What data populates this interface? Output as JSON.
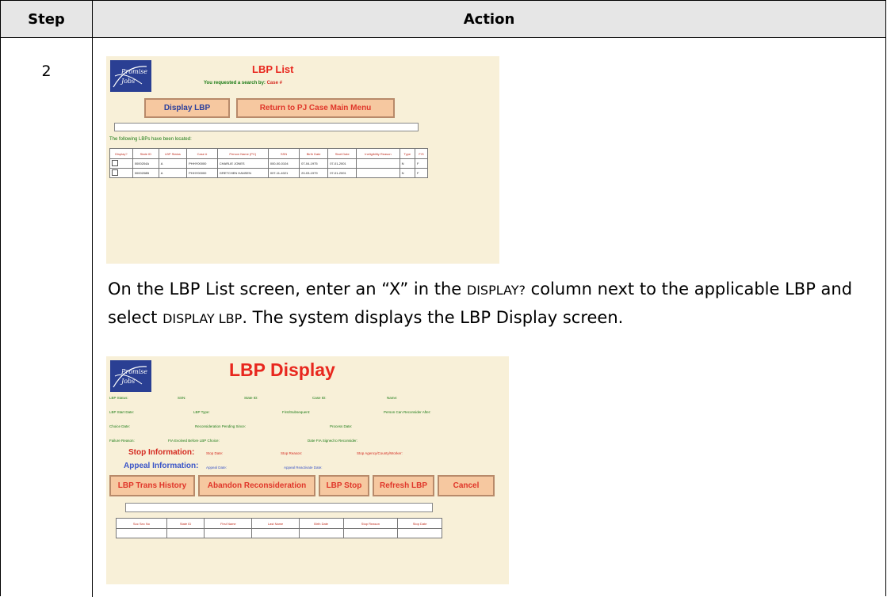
{
  "table": {
    "header_step": "Step",
    "header_action": "Action",
    "step_number": "2"
  },
  "instruction": {
    "part1": "On the LBP List screen, enter an “X” in the ",
    "display_col": "DISPLAY?",
    "part2": " column next to the applicable LBP and select ",
    "display_lbp": "DISPLAY LBP",
    "part3": ". The system displays the LBP Display screen."
  },
  "shot1": {
    "logo": "Promise Jobs",
    "title": "LBP List",
    "requested_prefix": "You requested a search by:",
    "requested_value": "Case #",
    "buttons": [
      "Display LBP",
      "Return to PJ Case Main Menu"
    ],
    "located_text": "The following LBPs have been located:",
    "columns": [
      "Display?",
      "State ID",
      "LBP Status",
      "Case #",
      "Person Name (PC)",
      "SSN",
      "Birth Date",
      "Start Date",
      "Ineligibility Reason",
      "Type",
      "F/S"
    ],
    "rows": [
      [
        "",
        "0000204A",
        "A",
        "PHHY00000",
        "CHARLIE JONES",
        "000-00-0104",
        "07-04-1975",
        "07-01-2001",
        "",
        "N",
        "F"
      ],
      [
        "",
        "0000208B",
        "A",
        "PHHY00000",
        "GRETCHEN HANSEN",
        "007-11-4021",
        "20-03-1979",
        "07-01-2001",
        "",
        "N",
        "F"
      ]
    ]
  },
  "shot2": {
    "logo": "Promise Jobs",
    "title": "LBP Display",
    "row1": [
      "LBP Status:",
      "SSN:",
      "State ID:",
      "Case ID:",
      "Name:"
    ],
    "row2": [
      "LBP Start Date:",
      "LBP Type:",
      "First/Subsequent:",
      "Person Can Reconsider After:"
    ],
    "row3": [
      "Choice Date:",
      "Reconsideration Pending Since:",
      "Process Date:"
    ],
    "row4": [
      "Failure Reason:",
      "FIA Evolved Before LBP Choice:",
      "Date FIA Signed to Reconsider:"
    ],
    "stop_label": "Stop Information:",
    "stop_fields": [
      "Stop Date:",
      "Stop Reason:",
      "Stop Agency/County/Worker:"
    ],
    "appeal_label": "Appeal Information:",
    "appeal_fields": [
      "Appeal Date:",
      "Appeal Reactivate Date:"
    ],
    "buttons": [
      "LBP Trans History",
      "Abandon Reconsideration",
      "LBP Stop",
      "Refresh LBP",
      "Cancel"
    ],
    "columns": [
      "Soc Sec No",
      "State ID",
      "First Name",
      "Last Name",
      "Birth Date",
      "Stop Reason",
      "Stop Date"
    ]
  },
  "colors": {
    "header_bg": "#e6e6e6",
    "screen_bg": "#f8f0d8",
    "title_red": "#e8271e",
    "label_green": "#1a7a14",
    "button_bg": "#f6c8a0",
    "logo_blue": "#2a3f93"
  }
}
